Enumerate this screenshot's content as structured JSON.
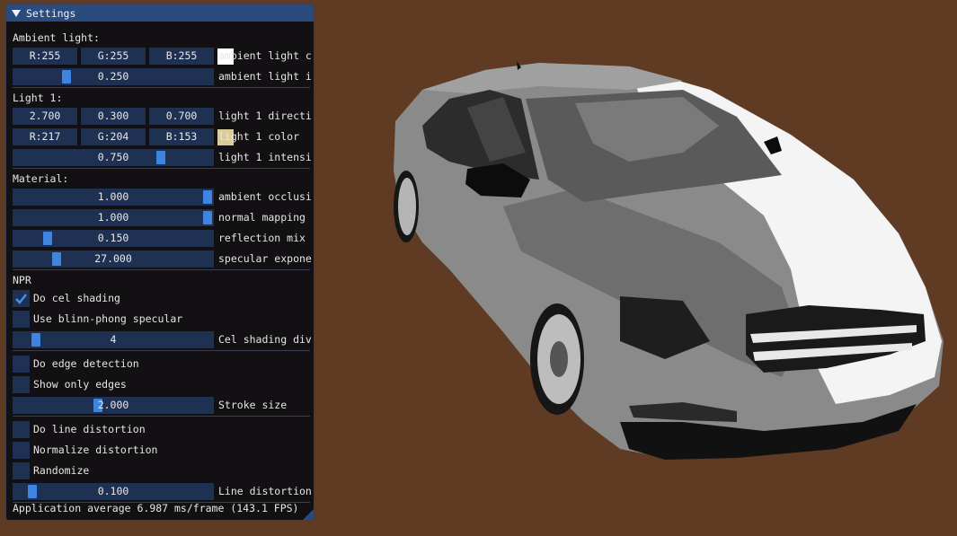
{
  "panel": {
    "title": "Settings",
    "ambient": {
      "heading": "Ambient light:",
      "r": "R:255",
      "g": "G:255",
      "b": "B:255",
      "swatch_color": "#ffffff",
      "color_label": "ambient light c",
      "intensity": "0.250",
      "intensity_label": "ambient light i",
      "intensity_fraction": 0.25
    },
    "light1": {
      "heading": "Light 1:",
      "dir_x": "2.700",
      "dir_y": "0.300",
      "dir_z": "0.700",
      "dir_label": "light 1 directi",
      "r": "R:217",
      "g": "G:204",
      "b": "B:153",
      "swatch_color": "#d9cc99",
      "color_label": "light 1 color",
      "intensity": "0.750",
      "intensity_label": "light 1 intensi",
      "intensity_fraction": 0.75
    },
    "material": {
      "heading": "Material:",
      "ao": "1.000",
      "ao_label": "ambient occlusi",
      "ao_fraction": 1.0,
      "normal": "1.000",
      "normal_label": "normal mapping",
      "normal_fraction": 1.0,
      "reflection": "0.150",
      "reflection_label": "reflection mix",
      "reflection_fraction": 0.15,
      "specular": "27.000",
      "specular_label": "specular expone",
      "specular_fraction": 0.2
    },
    "npr": {
      "heading": "NPR",
      "cel_label": "Do cel shading",
      "cel_checked": true,
      "blinn_label": "Use blinn-phong specular",
      "blinn_checked": false,
      "cel_div": "4",
      "cel_div_label": "Cel shading div",
      "cel_div_fraction": 0.09,
      "edge_label": "Do edge detection",
      "edge_checked": false,
      "only_edges_label": "Show only edges",
      "only_edges_checked": false,
      "stroke": "2.000",
      "stroke_label": "Stroke size",
      "stroke_fraction": 0.42,
      "line_dist_label": "Do line distortion",
      "line_dist_checked": false,
      "normalize_label": "Normalize distortion",
      "normalize_checked": false,
      "randomize_label": "Randomize",
      "randomize_checked": false,
      "line_dist": "0.100",
      "line_dist_value_label": "Line distortion",
      "line_dist_fraction": 0.07
    },
    "footer": "Application average 6.987 ms/frame (143.1 FPS)"
  },
  "colors": {
    "background": "#5e3b22",
    "accent": "#3d85e0",
    "frame": "#1f3153"
  }
}
